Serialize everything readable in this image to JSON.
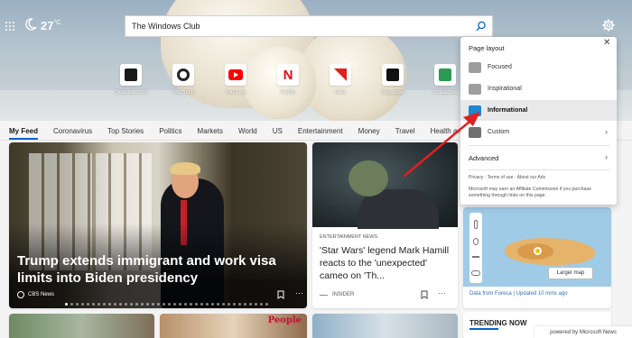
{
  "weather": {
    "temperature": "27",
    "unit": "°C",
    "icon": "moon-icon"
  },
  "search": {
    "value": "The Windows Club"
  },
  "quick_links": [
    {
      "label": "Goal.com US",
      "icon": "goal-icon",
      "color": "#1a1a1a"
    },
    {
      "label": "Wccftech",
      "icon": "wccftech-icon",
      "color": "#222222"
    },
    {
      "label": "YouTube",
      "icon": "youtube-icon",
      "color": "#ff0000"
    },
    {
      "label": "Netflix",
      "icon": "netflix-icon",
      "color": "#e50914"
    },
    {
      "label": "N4G",
      "icon": "n4g-icon",
      "color": "#e0211b"
    },
    {
      "label": "Engadget",
      "icon": "engadget-icon",
      "color": "#111111"
    },
    {
      "label": "SofaScore",
      "icon": "sofascore-icon",
      "color": "#2c9a53"
    }
  ],
  "nav": {
    "items": [
      "My Feed",
      "Coronavirus",
      "Top Stories",
      "Politics",
      "Markets",
      "World",
      "US",
      "Entertainment",
      "Money",
      "Travel",
      "Health and Fi"
    ]
  },
  "cards": {
    "main": {
      "title": "Trump extends immigrant and work visa limits into Biden presidency",
      "source": "CBS News"
    },
    "second": {
      "kicker": "ENTERTAINMENT NEWS",
      "title": "'Star Wars' legend Mark Hamill reacts to the 'unexpected' cameo on 'Th...",
      "source": "INSIDER"
    },
    "weather_map": {
      "button": "Larger map",
      "caption": "Data from Foreca | Updated 10 mins ago"
    },
    "people_logo": "People",
    "trending": "TRENDING NOW"
  },
  "powered_by": "powered by Microsoft News",
  "settings_panel": {
    "title": "Page layout",
    "options": [
      {
        "label": "Focused",
        "icon": "focused-layout-icon",
        "color": "#9e9e9e"
      },
      {
        "label": "Inspirational",
        "icon": "inspirational-layout-icon",
        "color": "#9e9e9e"
      },
      {
        "label": "Informational",
        "icon": "informational-layout-icon",
        "color": "#1f86d1",
        "selected": true
      },
      {
        "label": "Custom",
        "icon": "custom-layout-icon",
        "color": "#6f6f6f"
      }
    ],
    "advanced": "Advanced",
    "links": [
      "Privacy",
      "Terms of use",
      "About our Ads"
    ],
    "disclaimer": "Microsoft may earn an Affiliate Commission if you purchase something through links on this page."
  },
  "colors": {
    "accent": "#0b62c9",
    "arrow": "#e02020"
  }
}
